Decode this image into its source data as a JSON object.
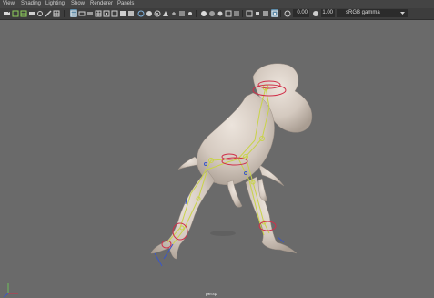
{
  "menu": [
    "View",
    "Shading",
    "Lighting",
    "Show",
    "Renderer",
    "Panels"
  ],
  "toolbar": {
    "exposure_value": "0.00",
    "gamma_value": "1.00",
    "color_space": "sRGB gamma"
  },
  "viewport": {
    "camera_label": "persp"
  },
  "colors": {
    "viewport_bg": "#6a6a6a",
    "model": "#d8cfc6",
    "joint": "#c9d34a",
    "control": "#d0304a"
  }
}
